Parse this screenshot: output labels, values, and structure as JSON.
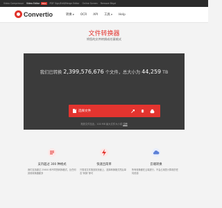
{
  "topbar": {
    "links": [
      {
        "label": "Video Compressor",
        "active": false
      },
      {
        "label": "Video Editor",
        "active": true,
        "badge": "New"
      },
      {
        "label": "PDF Sign/Edit/Merge Editor",
        "active": false
      },
      {
        "label": "Online Screen",
        "active": false
      },
      {
        "label": "Remove Bkgd",
        "active": false
      }
    ]
  },
  "header": {
    "brand": "Convertio",
    "nav": [
      "转换",
      "OCR",
      "API",
      "工具",
      "Help"
    ]
  },
  "hero": {
    "title": "文件转换器",
    "subtitle": "将您的文件转换成任意格式"
  },
  "panel": {
    "stats_prefix": "我们已转换",
    "stats_count": "2,399,576,676",
    "stats_mid": "个文件，总大小为",
    "stats_size": "44,259",
    "stats_unit": "TB",
    "choose_label": "选择文件",
    "drop_text": "拖放文件至此。100 MB 最大文件大小或",
    "drop_link": "注册"
  },
  "features": [
    {
      "icon": "format-icon",
      "heading": "支持超过 300 种格式",
      "text": "我们支持超过 25600 种不同的转换格式，比任何其他转换器都多"
    },
    {
      "icon": "lightning-icon",
      "heading": "快速且简单",
      "text": "只需将文件拖放到页面上，选择转换格式然后单击“转换”即可"
    },
    {
      "icon": "cloud-icon",
      "heading": "云端转换",
      "text": "所有转换都在云端进行，不会占用您计算机的任何资源"
    }
  ],
  "colors": {
    "accent": "#e3342f",
    "panel": "#3b3b3b",
    "background": "#f3f3f3"
  }
}
